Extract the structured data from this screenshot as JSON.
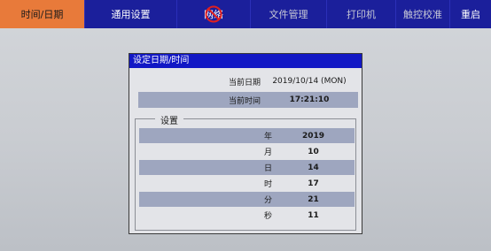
{
  "tabs": [
    {
      "label": "时间/日期",
      "active": true
    },
    {
      "label": "通用设置",
      "active": false
    },
    {
      "label": "网络",
      "active": false
    },
    {
      "label": "文件管理",
      "active": false
    },
    {
      "label": "打印机",
      "active": false
    },
    {
      "label": "触控校准",
      "active": false
    },
    {
      "label": "重启",
      "active": false
    }
  ],
  "panel": {
    "title": "设定日期/时间",
    "current_date_label": "当前日期",
    "current_date_value": "2019/10/14 (MON)",
    "current_time_label": "当前时间",
    "current_time_value": "17:21:10",
    "group_label": "设置",
    "settings": [
      {
        "label": "年",
        "value": "2019"
      },
      {
        "label": "月",
        "value": "10"
      },
      {
        "label": "日",
        "value": "14"
      },
      {
        "label": "时",
        "value": "17"
      },
      {
        "label": "分",
        "value": "21"
      },
      {
        "label": "秒",
        "value": "11"
      }
    ]
  },
  "colors": {
    "tabbar": "#1b1f9b",
    "active_tab": "#e87a3a",
    "title_bar": "#1218c5",
    "band": "#9ea6bf",
    "no_symbol": "#e02020"
  },
  "icons": {
    "network_overlay": "no-entry-icon"
  }
}
